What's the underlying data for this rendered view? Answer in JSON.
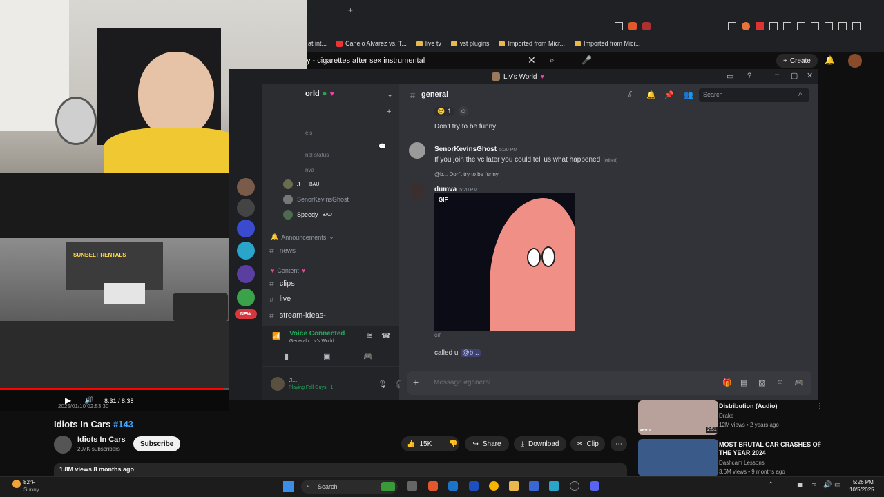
{
  "browser": {
    "bookmarks": [
      "at int...",
      "Canelo Alvarez vs. T...",
      "live tv",
      "vst plugins",
      "Imported from Micr...",
      "Imported from Micr..."
    ],
    "yt_tab_title": "y - cigarettes after sex instrumental",
    "create_label": "Create"
  },
  "discord": {
    "window_title": "Liv's World",
    "server_name": "orld",
    "channel_header": "general",
    "search_placeholder": "Search",
    "partial_category": "els",
    "partial_status": "nel status",
    "partial_voice": "nva",
    "voice_users": [
      {
        "name": "J...",
        "tag": "BAU"
      },
      {
        "name": "SenorKevinsGhost",
        "tag": ""
      },
      {
        "name": "Speedy",
        "tag": "BAU"
      }
    ],
    "categories": {
      "announcements": "Announcements",
      "content": "Content"
    },
    "channels": {
      "news": "news",
      "clips": "clips",
      "live": "live",
      "stream_ideas": "stream-ideas-"
    },
    "new_badge": "NEW",
    "voice_connected": "Voice Connected",
    "voice_location": "General / Liv's World",
    "user_panel": {
      "name": "J...",
      "status": "Playing Fall Guys +1"
    },
    "messages": {
      "reaction_count": "1",
      "msg1": "Don't try to be funny",
      "msg2_author": "SenorKevinsGhost",
      "msg2_time": "5:20 PM",
      "msg2_text": "If you join the vc later you could tell us what happened",
      "msg2_edited": "(edited)",
      "reply_preview": "@b... Don't try to be funny",
      "msg3_author": "dumva",
      "msg3_time": "5:20 PM",
      "gif_label": "GIF",
      "gif_caption": "GIF",
      "msg4_text": "called u",
      "msg4_mention": "@b..."
    },
    "message_placeholder": "Message #general"
  },
  "video": {
    "time": "8:31 / 8:38",
    "progress": 0.98,
    "overlay_timestamp": "2025/01/10 02:53:30",
    "sign_text": "SUNBELT RENTALS"
  },
  "youtube": {
    "title": "Idiots In Cars",
    "hashtag": "#143",
    "channel": "Idiots In Cars",
    "subscribers": "207K subscribers",
    "subscribe_label": "Subscribe",
    "likes": "15K",
    "share_label": "Share",
    "download_label": "Download",
    "clip_label": "Clip",
    "views_line": "1.8M views  8 months ago",
    "recs": [
      {
        "title": "Distribution (Audio)",
        "channel": "Drake",
        "meta": "12M views • 2 years ago",
        "duration": "2:51",
        "badge": "vevo"
      },
      {
        "title": "MOST BRUTAL CAR CRASHES OF THE YEAR 2024",
        "channel": "Dashcam Lessons",
        "meta": "3.6M views • 9 months ago",
        "duration": "",
        "badge": ""
      }
    ]
  },
  "taskbar": {
    "weather_temp": "82°F",
    "weather_desc": "Sunny",
    "search_label": "Search",
    "time": "5:26 PM",
    "date": "10/5/2025"
  },
  "colors": {
    "discord_blurple": "#5865f2",
    "voice_green": "#23a55a",
    "yt_red": "#ff0000",
    "accent_pink": "#eb459e"
  }
}
